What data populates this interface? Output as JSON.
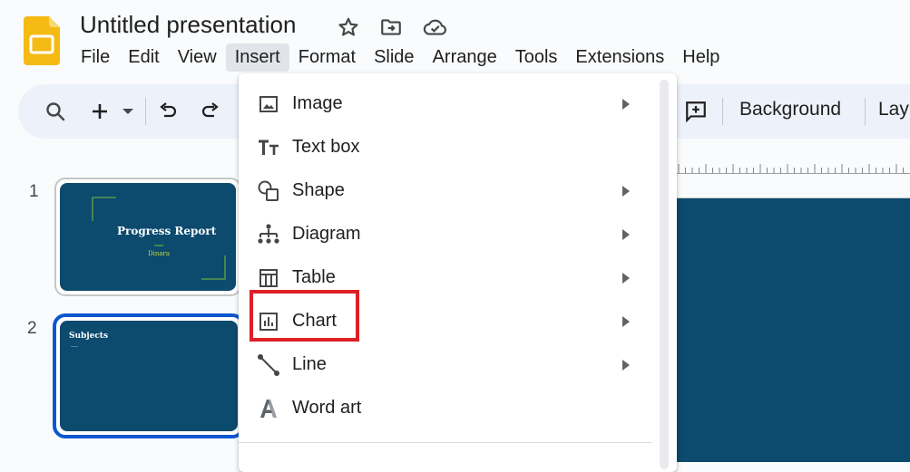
{
  "app": {
    "title": "Untitled presentation",
    "brand_color": "#f5ba14"
  },
  "menubar": {
    "items": [
      {
        "label": "File"
      },
      {
        "label": "Edit"
      },
      {
        "label": "View"
      },
      {
        "label": "Insert",
        "active": true
      },
      {
        "label": "Format"
      },
      {
        "label": "Slide"
      },
      {
        "label": "Arrange"
      },
      {
        "label": "Tools"
      },
      {
        "label": "Extensions"
      },
      {
        "label": "Help"
      }
    ]
  },
  "toolbar": {
    "background_label": "Background",
    "layout_label": "Lay",
    "icons": [
      "search-icon",
      "add-icon",
      "dropdown-arrow-icon",
      "undo-icon",
      "redo-icon",
      "add-comment-icon"
    ]
  },
  "slides": [
    {
      "number": "1",
      "title": "Progress Report",
      "subtitle": "Dinara"
    },
    {
      "number": "2",
      "title": "Subjects",
      "selected": true
    }
  ],
  "insert_menu": {
    "items": [
      {
        "label": "Image",
        "icon": "image-icon",
        "submenu": true
      },
      {
        "label": "Text box",
        "icon": "text-box-icon",
        "submenu": false
      },
      {
        "label": "Shape",
        "icon": "shape-icon",
        "submenu": true
      },
      {
        "label": "Diagram",
        "icon": "diagram-icon",
        "submenu": true
      },
      {
        "label": "Table",
        "icon": "table-icon",
        "submenu": true
      },
      {
        "label": "Chart",
        "icon": "chart-icon",
        "submenu": true,
        "highlighted": true
      },
      {
        "label": "Line",
        "icon": "line-icon",
        "submenu": true
      },
      {
        "label": "Word art",
        "icon": "word-art-icon",
        "submenu": false
      }
    ]
  },
  "colors": {
    "slide_bg": "#0c4a6e",
    "accent_green": "#c7d83c",
    "selection_blue": "#0b57d0",
    "highlight_red": "#dd1f26"
  }
}
